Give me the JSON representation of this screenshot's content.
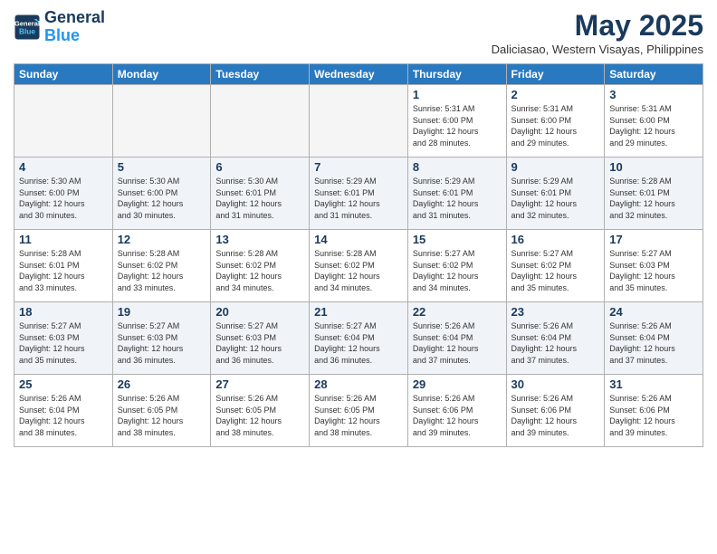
{
  "logo": {
    "line1": "General",
    "line2": "Blue"
  },
  "title": "May 2025",
  "location": "Daliciasao, Western Visayas, Philippines",
  "days_of_week": [
    "Sunday",
    "Monday",
    "Tuesday",
    "Wednesday",
    "Thursday",
    "Friday",
    "Saturday"
  ],
  "weeks": [
    [
      {
        "day": "",
        "info": ""
      },
      {
        "day": "",
        "info": ""
      },
      {
        "day": "",
        "info": ""
      },
      {
        "day": "",
        "info": ""
      },
      {
        "day": "1",
        "info": "Sunrise: 5:31 AM\nSunset: 6:00 PM\nDaylight: 12 hours\nand 28 minutes."
      },
      {
        "day": "2",
        "info": "Sunrise: 5:31 AM\nSunset: 6:00 PM\nDaylight: 12 hours\nand 29 minutes."
      },
      {
        "day": "3",
        "info": "Sunrise: 5:31 AM\nSunset: 6:00 PM\nDaylight: 12 hours\nand 29 minutes."
      }
    ],
    [
      {
        "day": "4",
        "info": "Sunrise: 5:30 AM\nSunset: 6:00 PM\nDaylight: 12 hours\nand 30 minutes."
      },
      {
        "day": "5",
        "info": "Sunrise: 5:30 AM\nSunset: 6:00 PM\nDaylight: 12 hours\nand 30 minutes."
      },
      {
        "day": "6",
        "info": "Sunrise: 5:30 AM\nSunset: 6:01 PM\nDaylight: 12 hours\nand 31 minutes."
      },
      {
        "day": "7",
        "info": "Sunrise: 5:29 AM\nSunset: 6:01 PM\nDaylight: 12 hours\nand 31 minutes."
      },
      {
        "day": "8",
        "info": "Sunrise: 5:29 AM\nSunset: 6:01 PM\nDaylight: 12 hours\nand 31 minutes."
      },
      {
        "day": "9",
        "info": "Sunrise: 5:29 AM\nSunset: 6:01 PM\nDaylight: 12 hours\nand 32 minutes."
      },
      {
        "day": "10",
        "info": "Sunrise: 5:28 AM\nSunset: 6:01 PM\nDaylight: 12 hours\nand 32 minutes."
      }
    ],
    [
      {
        "day": "11",
        "info": "Sunrise: 5:28 AM\nSunset: 6:01 PM\nDaylight: 12 hours\nand 33 minutes."
      },
      {
        "day": "12",
        "info": "Sunrise: 5:28 AM\nSunset: 6:02 PM\nDaylight: 12 hours\nand 33 minutes."
      },
      {
        "day": "13",
        "info": "Sunrise: 5:28 AM\nSunset: 6:02 PM\nDaylight: 12 hours\nand 34 minutes."
      },
      {
        "day": "14",
        "info": "Sunrise: 5:28 AM\nSunset: 6:02 PM\nDaylight: 12 hours\nand 34 minutes."
      },
      {
        "day": "15",
        "info": "Sunrise: 5:27 AM\nSunset: 6:02 PM\nDaylight: 12 hours\nand 34 minutes."
      },
      {
        "day": "16",
        "info": "Sunrise: 5:27 AM\nSunset: 6:02 PM\nDaylight: 12 hours\nand 35 minutes."
      },
      {
        "day": "17",
        "info": "Sunrise: 5:27 AM\nSunset: 6:03 PM\nDaylight: 12 hours\nand 35 minutes."
      }
    ],
    [
      {
        "day": "18",
        "info": "Sunrise: 5:27 AM\nSunset: 6:03 PM\nDaylight: 12 hours\nand 35 minutes."
      },
      {
        "day": "19",
        "info": "Sunrise: 5:27 AM\nSunset: 6:03 PM\nDaylight: 12 hours\nand 36 minutes."
      },
      {
        "day": "20",
        "info": "Sunrise: 5:27 AM\nSunset: 6:03 PM\nDaylight: 12 hours\nand 36 minutes."
      },
      {
        "day": "21",
        "info": "Sunrise: 5:27 AM\nSunset: 6:04 PM\nDaylight: 12 hours\nand 36 minutes."
      },
      {
        "day": "22",
        "info": "Sunrise: 5:26 AM\nSunset: 6:04 PM\nDaylight: 12 hours\nand 37 minutes."
      },
      {
        "day": "23",
        "info": "Sunrise: 5:26 AM\nSunset: 6:04 PM\nDaylight: 12 hours\nand 37 minutes."
      },
      {
        "day": "24",
        "info": "Sunrise: 5:26 AM\nSunset: 6:04 PM\nDaylight: 12 hours\nand 37 minutes."
      }
    ],
    [
      {
        "day": "25",
        "info": "Sunrise: 5:26 AM\nSunset: 6:04 PM\nDaylight: 12 hours\nand 38 minutes."
      },
      {
        "day": "26",
        "info": "Sunrise: 5:26 AM\nSunset: 6:05 PM\nDaylight: 12 hours\nand 38 minutes."
      },
      {
        "day": "27",
        "info": "Sunrise: 5:26 AM\nSunset: 6:05 PM\nDaylight: 12 hours\nand 38 minutes."
      },
      {
        "day": "28",
        "info": "Sunrise: 5:26 AM\nSunset: 6:05 PM\nDaylight: 12 hours\nand 38 minutes."
      },
      {
        "day": "29",
        "info": "Sunrise: 5:26 AM\nSunset: 6:06 PM\nDaylight: 12 hours\nand 39 minutes."
      },
      {
        "day": "30",
        "info": "Sunrise: 5:26 AM\nSunset: 6:06 PM\nDaylight: 12 hours\nand 39 minutes."
      },
      {
        "day": "31",
        "info": "Sunrise: 5:26 AM\nSunset: 6:06 PM\nDaylight: 12 hours\nand 39 minutes."
      }
    ]
  ],
  "colors": {
    "header_bg": "#2979c0",
    "title_color": "#1a3a5c"
  }
}
